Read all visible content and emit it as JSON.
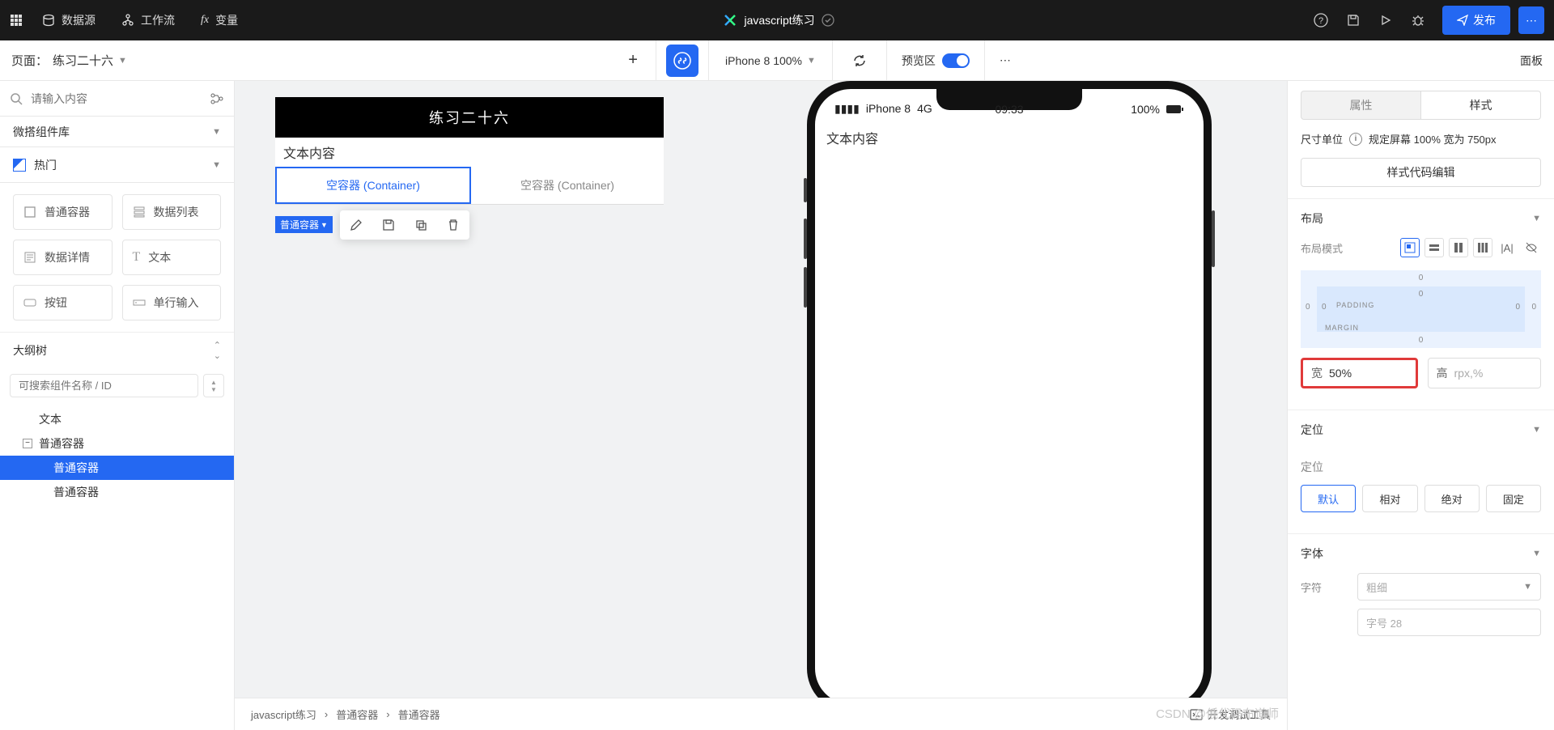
{
  "topnav": {
    "datasource": "数据源",
    "workflow": "工作流",
    "variable": "变量",
    "app_title": "javascript练习",
    "publish": "发布"
  },
  "secondbar": {
    "page_prefix": "页面：",
    "page_name": "练习二十六",
    "device": "iPhone 8 100%",
    "preview_label": "预览区",
    "panel": "面板"
  },
  "left": {
    "search_placeholder": "请输入内容",
    "lib_title": "微搭组件库",
    "hot": "热门",
    "components": {
      "container": "普通容器",
      "datalist": "数据列表",
      "datadetail": "数据详情",
      "text": "文本",
      "button": "按钮",
      "input": "单行输入"
    },
    "outline_title": "大纲树",
    "outline_search_placeholder": "可搜索组件名称 / ID",
    "tree": {
      "n1": "文本",
      "n2": "普通容器",
      "n3": "普通容器",
      "n4": "普通容器"
    }
  },
  "canvas": {
    "header_title": "练习二十六",
    "text_content": "文本内容",
    "container_label": "空容器 (Container)",
    "selected_tag": "普通容器"
  },
  "phone": {
    "carrier": "iPhone 8",
    "network": "4G",
    "time": "09:33",
    "battery": "100%",
    "content": "文本内容"
  },
  "breadcrumb": {
    "b1": "javascript练习",
    "b2": "普通容器",
    "b3": "普通容器",
    "debug": "开发调试工具"
  },
  "right": {
    "tab_attr": "属性",
    "tab_style": "样式",
    "size_label": "尺寸单位",
    "size_desc": "规定屏幕 100% 宽为 750px",
    "code_edit": "样式代码编辑",
    "layout": {
      "title": "布局",
      "mode_label": "布局模式",
      "padding": "PADDING",
      "margin": "MARGIN",
      "zero": "0",
      "width_label": "宽",
      "width_value": "50%",
      "height_label": "高",
      "height_placeholder": "rpx,%"
    },
    "position": {
      "title": "定位",
      "label": "定位",
      "default": "默认",
      "relative": "相对",
      "absolute": "绝对",
      "fixed": "固定"
    },
    "font": {
      "title": "字体",
      "char_label": "字符",
      "weight_ph": "粗细",
      "size_label": "字号",
      "size_ph": "28"
    }
  },
  "watermark": "CSDN @低代码布道师"
}
